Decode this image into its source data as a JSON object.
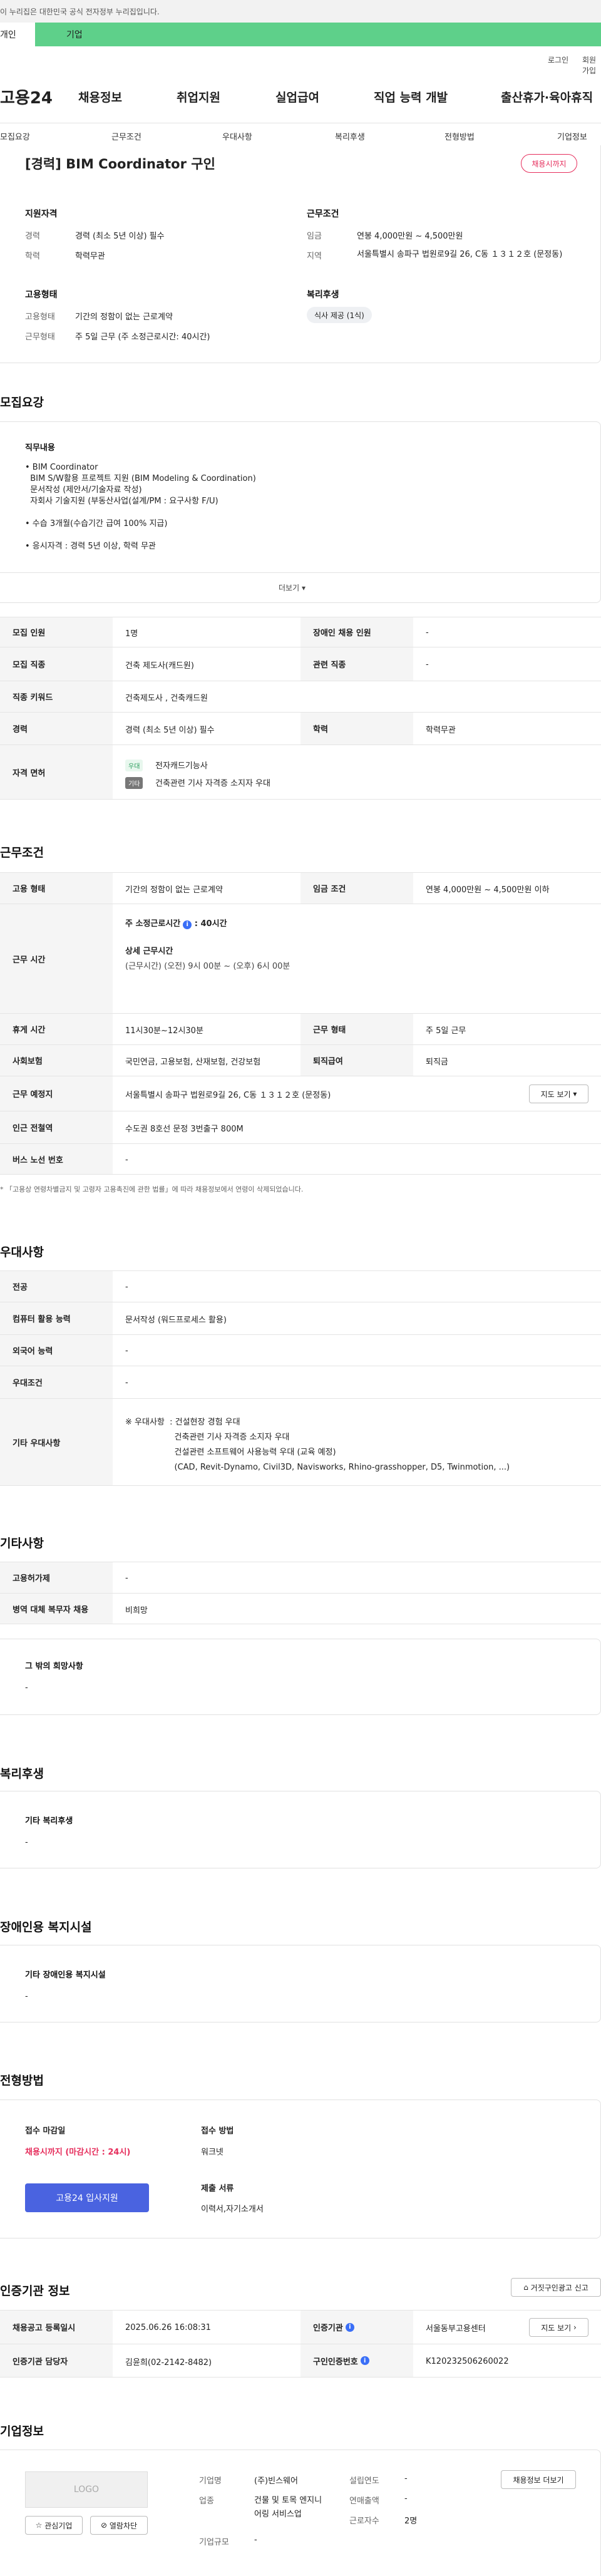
{
  "gov_banner": {
    "notice": "이 누리집은 대한민국 공식 전자정부 누리집입니다.",
    "tab_personal": "개인",
    "tab_company": "기업"
  },
  "util": {
    "login": "로그인",
    "signup": "회원가입"
  },
  "brand": {
    "logo": "고용24"
  },
  "gnb": [
    "채용정보",
    "취업지원",
    "실업급여",
    "직업 능력 개발",
    "출산휴가·육아휴직"
  ],
  "subnav": [
    "모집요강",
    "근무조건",
    "우대사항",
    "복리후생",
    "전형방법",
    "기업정보"
  ],
  "header": {
    "title": "[경력] BIM Coordinator 구인",
    "badge": "채용시까지",
    "left_section": "지원자격",
    "left_rows": [
      {
        "k": "경력",
        "v": "경력 (최소 5년 이상) 필수"
      },
      {
        "k": "학력",
        "v": "학력무관"
      }
    ],
    "left2_section": "고용형태",
    "left2_rows": [
      {
        "k": "고용형태",
        "v": "기간의 정함이 없는 근로계약"
      },
      {
        "k": "근무형태",
        "v": "주 5일 근무 (주 소정근로시간: 40시간)"
      }
    ],
    "right_section": "근무조건",
    "right_rows": [
      {
        "k": "임금",
        "v": "연봉 4,000만원 ~ 4,500만원"
      },
      {
        "k": "지역",
        "v": "서울특별시 송파구 법원로9길 26, C동 １３１２호 (문정동)"
      }
    ],
    "right2_section": "복리후생",
    "welfare_tag": "식사 제공 (1식)"
  },
  "recruit": {
    "title": "모집요강",
    "duty_label": "직무내용",
    "duty_lines": [
      "• BIM Coordinator",
      "  BIM S/W활용 프로젝트 지원 (BIM Modeling & Coordination)",
      "  문서작성 (제안서/기술자료 작성)",
      "  자회사 기술지원 (부동산사업(설계/PM : 요구사항 F/U)",
      "",
      "• 수습 3개월(수습기간 급여 100% 지급)",
      "",
      "• 응시자격 : 경력 5년 이상, 학력 무관"
    ],
    "more": "더보기",
    "rows": [
      {
        "l1": "모집 인원",
        "v1": "1명",
        "l2": "장애인 채용 인원",
        "v2": "-"
      },
      {
        "l1": "모집 직종",
        "v1": "건축 제도사(캐드원)",
        "l2": "관련 직종",
        "v2": "-"
      },
      {
        "l1": "직종 키워드",
        "v1": "건축제도사 , 건축캐드원"
      },
      {
        "l1": "경력",
        "v1": "경력 (최소 5년 이상) 필수",
        "l2": "학력",
        "v2": "학력무관"
      }
    ],
    "license_label": "자격 면허",
    "license_tag1": "우대",
    "license_v1": "전자캐드기능사",
    "license_tag2": "기타",
    "license_v2": "건축관련 기사 자격증 소지자 우대"
  },
  "work": {
    "title": "근무조건",
    "r1": {
      "l1": "고용 형태",
      "v1": "기간의 정함이 없는 근로계약",
      "l2": "임금 조건",
      "v2": "연봉 4,000만원 ~ 4,500만원 이하"
    },
    "hours_label": "근무 시간",
    "hours_main": "주 소정근로시간",
    "hours_value": "40시간",
    "hours_detail_label": "상세 근무시간",
    "hours_detail": "(근무시간) (오전) 9시 00분 ~ (오후) 6시 00분",
    "r3": {
      "l1": "휴게 시간",
      "v1": "11시30분~12시30분",
      "l2": "근무 형태",
      "v2": "주 5일 근무"
    },
    "r4": {
      "l1": "사회보험",
      "v1": "국민연금, 고용보험, 산재보험, 건강보험",
      "l2": "퇴직급여",
      "v2": "퇴직금"
    },
    "r5": {
      "l1": "근무 예정지",
      "v1": "서울특별시 송파구 법원로9길 26, C동 １３１２호 (문정동)"
    },
    "map_btn": "지도 보기",
    "r6": {
      "l1": "인근 전철역",
      "v1": "수도권 8호선 문정 3번출구 800M"
    },
    "r7": {
      "l1": "버스 노선 번호",
      "v1": "-"
    },
    "notice": "「고용상 연령차별금지 및 고령자 고용촉진에 관한 법률」에 따라 채용정보에서 연령이 삭제되었습니다."
  },
  "pref": {
    "title": "우대사항",
    "rows": [
      {
        "l": "전공",
        "v": "-"
      },
      {
        "l": "컴퓨터 활용 능력",
        "v": "문서작성 (워드프로세스 활용)"
      },
      {
        "l": "외국어 능력",
        "v": "-"
      },
      {
        "l": "우대조건",
        "v": "-"
      }
    ],
    "etc_label": "기타 우대사항",
    "etc_lines": [
      "※ 우대사항  : 건설현장 경험 우대",
      "                   건축관련 기사 자격증 소지자 우대",
      "                   건설관련 소프트웨어 사용능력 우대 (교육 예정)",
      "                   (CAD, Revit-Dynamo, Civil3D, Navisworks, Rhino-grasshopper, D5, Twinmotion, ...)"
    ]
  },
  "other": {
    "title": "기타사항",
    "rows": [
      {
        "l": "고용허가제",
        "v": "-"
      },
      {
        "l": "병역 대체 복무자 채용",
        "v": "비희망"
      }
    ],
    "box_title": "그 밖의 희망사항",
    "box_val": "-"
  },
  "welfare": {
    "title": "복리후생",
    "box_title": "기타 복리후생",
    "box_val": "-"
  },
  "disabled": {
    "title": "장애인용 복지시설",
    "box_title": "기타 장애인용 복지시설",
    "box_val": "-"
  },
  "process": {
    "title": "전형방법",
    "deadline_label": "접수 마감일",
    "deadline_val": "채용시까지 (마감시간 : 24시)",
    "apply_btn": "고용24 입사지원",
    "method_label": "접수 방법",
    "method_val": "워크넷",
    "docs_label": "제출 서류",
    "docs_val": "이력서,자기소개서"
  },
  "cert": {
    "title": "인증기관 정보",
    "report_btn": "거짓구인광고 신고",
    "r1": {
      "l1": "채용공고 등록일시",
      "v1": "2025.06.26 16:08:31",
      "l2": "인증기관",
      "v2": "서울동부고용센터"
    },
    "map_btn": "지도 보기",
    "r2": {
      "l1": "인증기관 담당자",
      "v1": "김윤희(02-2142-8482)",
      "l2": "구인인증번호",
      "v2": "K120232506260022"
    }
  },
  "company": {
    "title": "기업정보",
    "logo": "LOGO",
    "fav_btn": "관심기업",
    "block_btn": "열람차단",
    "name_label": "기업명",
    "name_val": "(주)빈스웨어",
    "industry_label": "업종",
    "industry_val": "건물 및 토목 엔지니어링 서비스업",
    "size_label": "기업규모",
    "size_val": "-",
    "founded_label": "설립연도",
    "founded_val": "-",
    "sales_label": "연매출액",
    "sales_val": "-",
    "emp_label": "근로자수",
    "emp_val": "2명",
    "jobs_btn": "채용정보 더보기"
  },
  "colors": {
    "green": "#5ed08a",
    "accent": "#4a63e0",
    "red": "#e62e5c"
  }
}
